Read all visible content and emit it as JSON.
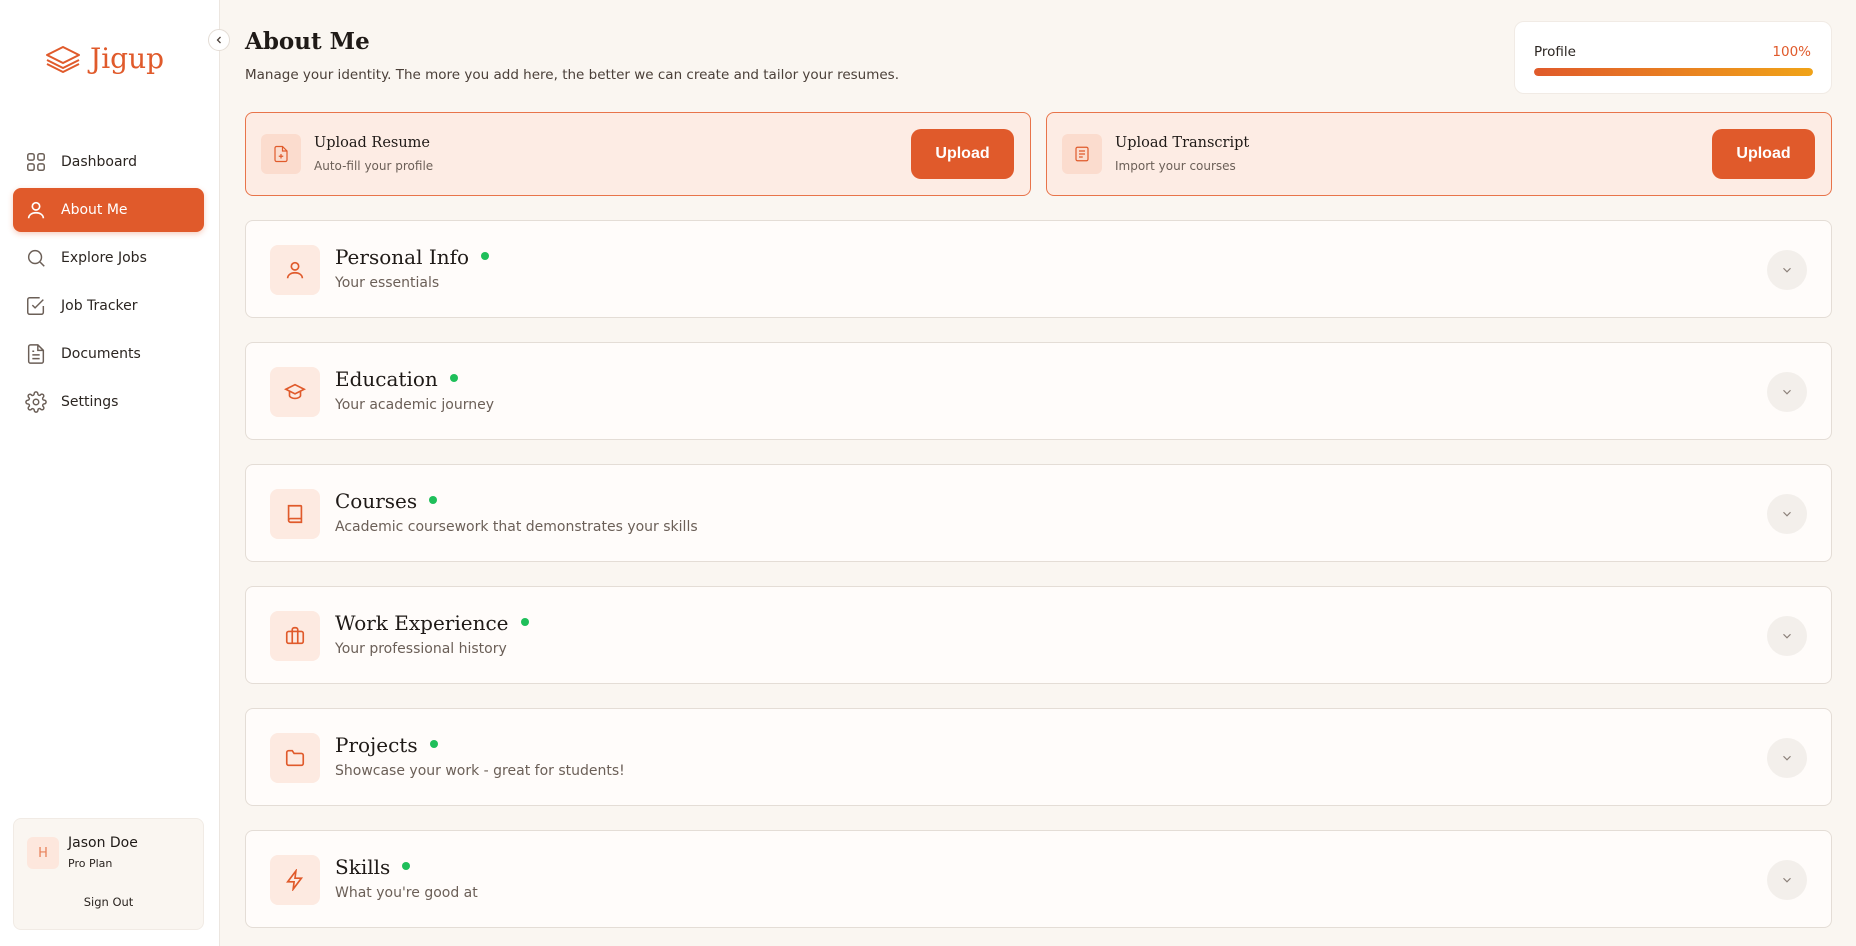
{
  "brand": {
    "name": "Jigup",
    "accent": "#e05a2b"
  },
  "sidebar": {
    "items": [
      {
        "label": "Dashboard",
        "icon": "grid-icon",
        "active": false
      },
      {
        "label": "About Me",
        "icon": "user-icon",
        "active": true
      },
      {
        "label": "Explore Jobs",
        "icon": "search-icon",
        "active": false
      },
      {
        "label": "Job Tracker",
        "icon": "checkbox-icon",
        "active": false
      },
      {
        "label": "Documents",
        "icon": "document-icon",
        "active": false
      },
      {
        "label": "Settings",
        "icon": "gear-icon",
        "active": false
      }
    ],
    "user": {
      "initial": "H",
      "name": "Jason Doe",
      "plan": "Pro Plan",
      "signout": "Sign Out"
    }
  },
  "header": {
    "title": "About Me",
    "subtitle": "Manage your identity. The more you add here, the better we can create and tailor your resumes."
  },
  "profile": {
    "label": "Profile",
    "percent_text": "100%",
    "percent": 100
  },
  "uploads": [
    {
      "title": "Upload Resume",
      "subtitle": "Auto-fill your profile",
      "button": "Upload",
      "icon": "file-plus-icon"
    },
    {
      "title": "Upload Transcript",
      "subtitle": "Import your courses",
      "button": "Upload",
      "icon": "transcript-icon"
    }
  ],
  "sections": [
    {
      "title": "Personal Info",
      "subtitle": "Your essentials",
      "icon": "user-icon",
      "complete": true
    },
    {
      "title": "Education",
      "subtitle": "Your academic journey",
      "icon": "graduation-cap-icon",
      "complete": true
    },
    {
      "title": "Courses",
      "subtitle": "Academic coursework that demonstrates your skills",
      "icon": "book-icon",
      "complete": true
    },
    {
      "title": "Work Experience",
      "subtitle": "Your professional history",
      "icon": "briefcase-icon",
      "complete": true
    },
    {
      "title": "Projects",
      "subtitle": "Showcase your work - great for students!",
      "icon": "folder-icon",
      "complete": true
    },
    {
      "title": "Skills",
      "subtitle": "What you're good at",
      "icon": "lightning-icon",
      "complete": true
    }
  ]
}
